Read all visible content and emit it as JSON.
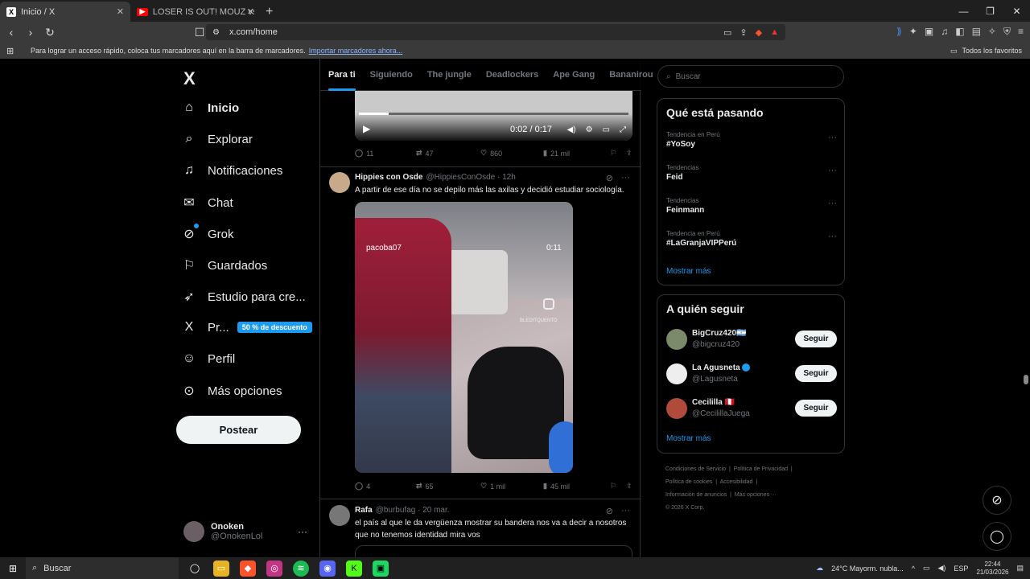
{
  "browser": {
    "tabs": [
      {
        "title": "Inicio / X",
        "active": true
      },
      {
        "title": "LOSER IS OUT! MOUZ vs 9z - Official",
        "active": false
      }
    ],
    "new_tab": "+",
    "url": "x.com/home",
    "bookmarks_prompt": "Para lograr un acceso rápido, coloca tus marcadores aquí en la barra de marcadores.",
    "import_link": "Importar marcadores ahora...",
    "all_favorites": "Todos los favoritos"
  },
  "sidebar": {
    "logo": "X",
    "items": [
      {
        "label": "Inicio",
        "icon": "home-icon"
      },
      {
        "label": "Explorar",
        "icon": "search-icon"
      },
      {
        "label": "Notificaciones",
        "icon": "bell-icon"
      },
      {
        "label": "Chat",
        "icon": "mail-icon"
      },
      {
        "label": "Grok",
        "icon": "grok-icon"
      },
      {
        "label": "Guardados",
        "icon": "bookmark-icon"
      },
      {
        "label": "Estudio para cre...",
        "icon": "rocket-icon"
      },
      {
        "label": "Pr...",
        "icon": "x-premium-icon"
      },
      {
        "label": "Perfil",
        "icon": "person-icon"
      },
      {
        "label": "Más opciones",
        "icon": "more-circle-icon"
      }
    ],
    "promo_badge": "50 % de descuento",
    "post_button": "Postear",
    "account": {
      "name": "Onoken",
      "handle": "@OnokenLol",
      "more": "···"
    }
  },
  "feed": {
    "tabs": [
      "Para ti",
      "Siguiendo",
      "The jungle",
      "Deadlockers",
      "Ape Gang",
      "Bananirou"
    ],
    "posts": [
      {
        "video_time": "0:02 / 0:17",
        "video_progress": 0.11,
        "replies": "11",
        "reposts": "47",
        "likes": "860",
        "views": "21 mil"
      },
      {
        "name": "Hippies con Osde",
        "handle": "@HippiesConOsde · 12h",
        "text": "A partir de ese día no se depilo más las axilas y decidió estudiar sociología.",
        "video_user": "pacoba07",
        "video_time": "0:11",
        "watermark": "BLEDITQUENTO",
        "replies": "4",
        "reposts": "65",
        "likes": "1 mil",
        "views": "45 mil"
      },
      {
        "name": "Rafa",
        "handle": "@burbufag · 20 mar.",
        "text": "el país al que le da vergüenza mostrar su bandera nos va a decir a nosotros que no tenemos identidad mira vos"
      }
    ]
  },
  "right": {
    "search_placeholder": "Buscar",
    "trending_title": "Qué está pasando",
    "trends": [
      {
        "context": "Tendencia en Perú",
        "topic": "#YoSoy"
      },
      {
        "context": "Tendencias",
        "topic": "Feid"
      },
      {
        "context": "Tendencias",
        "topic": "Feinmann"
      },
      {
        "context": "Tendencia en Perú",
        "topic": "#LaGranjaVIPPerú"
      }
    ],
    "show_more": "Mostrar más",
    "follow_title": "A quién seguir",
    "follow": [
      {
        "name": "BigCruz420🇦🇷",
        "handle": "@bigcruz420"
      },
      {
        "name": "La Agusneta",
        "handle": "@Lagusneta"
      },
      {
        "name": "Cecililla 🇵🇪",
        "handle": "@CecilillaJuega"
      }
    ],
    "follow_button": "Seguir",
    "footer": [
      "Condiciones de Servicio",
      "Política de Privacidad",
      "Política de cookies",
      "Accesibilidad",
      "Información de anuncios",
      "Más opciones ···",
      "© 2026 X Corp."
    ]
  },
  "taskbar": {
    "search": "Buscar",
    "weather": "24°C  Mayorm. nubla...",
    "lang": "ESP",
    "time": "22:44",
    "date": "21/03/2026"
  }
}
